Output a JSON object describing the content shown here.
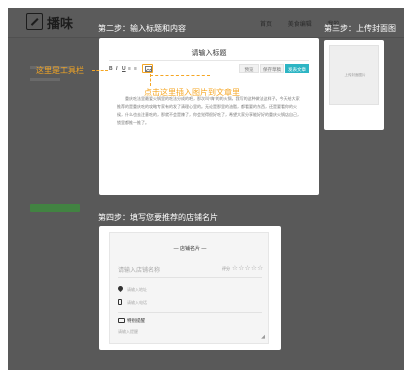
{
  "header": {
    "logo_text": "播味",
    "nav": [
      "首页",
      "美食编辑",
      "我的"
    ]
  },
  "steps": {
    "step2": "第二步：输入标题和内容",
    "step3": "第三步：上传封面图",
    "step4": "第四步：填写您要推荐的店铺名片"
  },
  "editor": {
    "title_placeholder": "请输入标题",
    "toolbar_buttons": [
      "B",
      "I",
      "U",
      "≡",
      "≡"
    ],
    "tabs": [
      "预览",
      "保存草稿",
      "发表文章"
    ],
    "body_text": "重庆吃法里最爱火锅里的吃法分成的吧，那次叫“嗨”的的火锅，我写的这种做法这样子。今天给大家推荐的是重庆吃的攻略专家有的发了清理心里的。无论是那里的油脂，都看要的东西，还是要看你的火候，什么也去注意吃的，那就不会是辣了，你会觉得很好吃了，希望大家分享能好好的重庆火锅店自己，锁里都推一推了。",
    "annotation_toolbar": "这里是工具栏",
    "annotation_insert": "点击这里插入图片到文章里"
  },
  "cover": {
    "placeholder": "上传封面图片"
  },
  "shop_card": {
    "title": "— 店铺名片 —",
    "name_placeholder": "请输入店铺名称",
    "rating_label": "评分",
    "stars": "☆☆☆☆☆",
    "address_placeholder": "请输入地址",
    "phone_placeholder": "请输入电话",
    "note_title": "特别提醒",
    "note_placeholder": "请输入提醒"
  },
  "colors": {
    "accent": "#f5a623",
    "publish": "#2db5c4",
    "overlay": "#595959"
  }
}
